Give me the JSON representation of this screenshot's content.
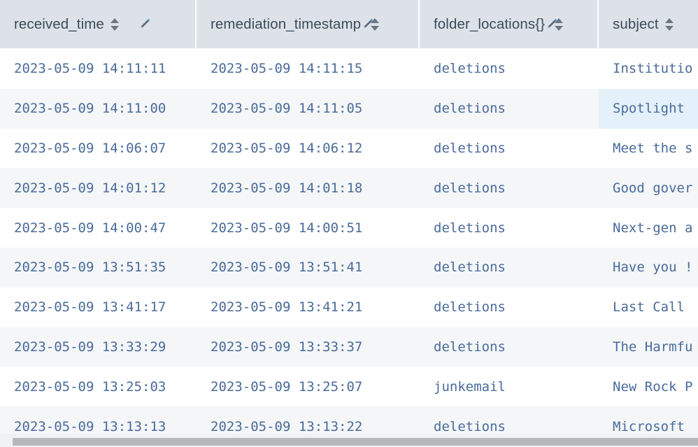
{
  "table": {
    "columns": [
      {
        "key": "received_time",
        "label": "received_time",
        "icons": [
          "sort-icon",
          "pencil-icon"
        ],
        "sortable": true
      },
      {
        "key": "remediation_timestamp",
        "label": "remediation_timestamp",
        "icons": [
          "pencil-icon",
          "sort-icon"
        ],
        "sortable": true
      },
      {
        "key": "folder_locations",
        "label": "folder_locations{}",
        "icons": [
          "pencil-icon",
          "sort-icon"
        ],
        "sortable": true
      },
      {
        "key": "subject",
        "label": "subject",
        "icons": [
          "sort-icon"
        ],
        "sortable": true
      }
    ],
    "rows": [
      {
        "received_time": "2023-05-09 14:11:11",
        "remediation_timestamp": "2023-05-09 14:11:15",
        "folder_locations": "deletions",
        "subject": "Institutio"
      },
      {
        "received_time": "2023-05-09 14:11:00",
        "remediation_timestamp": "2023-05-09 14:11:05",
        "folder_locations": "deletions",
        "subject": "Spotlight"
      },
      {
        "received_time": "2023-05-09 14:06:07",
        "remediation_timestamp": "2023-05-09 14:06:12",
        "folder_locations": "deletions",
        "subject": "Meet the s"
      },
      {
        "received_time": "2023-05-09 14:01:12",
        "remediation_timestamp": "2023-05-09 14:01:18",
        "folder_locations": "deletions",
        "subject": "Good gover"
      },
      {
        "received_time": "2023-05-09 14:00:47",
        "remediation_timestamp": "2023-05-09 14:00:51",
        "folder_locations": "deletions",
        "subject": "Next-gen a"
      },
      {
        "received_time": "2023-05-09 13:51:35",
        "remediation_timestamp": "2023-05-09 13:51:41",
        "folder_locations": "deletions",
        "subject": "Have you !"
      },
      {
        "received_time": "2023-05-09 13:41:17",
        "remediation_timestamp": "2023-05-09 13:41:21",
        "folder_locations": "deletions",
        "subject": "Last Call"
      },
      {
        "received_time": "2023-05-09 13:33:29",
        "remediation_timestamp": "2023-05-09 13:33:37",
        "folder_locations": "deletions",
        "subject": "The Harmfu"
      },
      {
        "received_time": "2023-05-09 13:25:03",
        "remediation_timestamp": "2023-05-09 13:25:07",
        "folder_locations": "junkemail",
        "subject": "New Rock P"
      },
      {
        "received_time": "2023-05-09 13:13:13",
        "remediation_timestamp": "2023-05-09 13:13:22",
        "folder_locations": "deletions",
        "subject": "Microsoft"
      }
    ],
    "hovered_cell": {
      "row_index": 1,
      "column_key": "subject"
    }
  },
  "colors": {
    "header_background": "#dde2e8",
    "header_text": "#3c4a5a",
    "cell_text": "#4a6b9a",
    "row_odd_background": "#ffffff",
    "row_even_background": "#f4f6f8",
    "hover_background": "#e4f1fb",
    "scrollbar_thumb": "#b6b8bb",
    "scrollbar_track": "#f1f2f4"
  },
  "scrollbar": {
    "orientation": "horizontal",
    "thumb_label": "horizontal-scroll-thumb"
  }
}
